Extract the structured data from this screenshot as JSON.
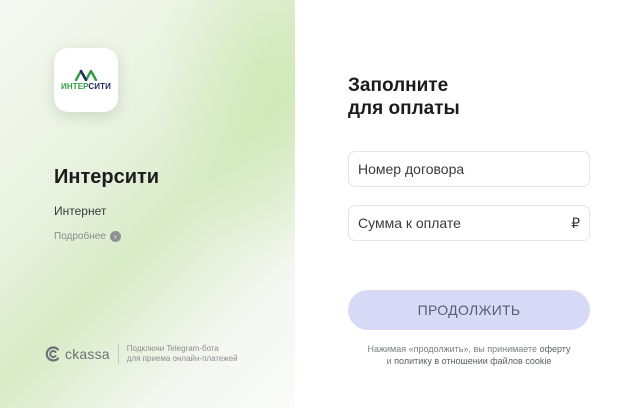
{
  "merchant": {
    "logo_text_green": "ИНТЕР",
    "logo_text_blue": "СИТИ",
    "name": "Интерсити",
    "service": "Интернет",
    "more_link": "Подробнее",
    "more_icon": "chevron-right-icon"
  },
  "footer": {
    "brand": "ckassa",
    "promo_line1": "Подключи Telegram-бота",
    "promo_line2": "для приема онлайн-платежей"
  },
  "form": {
    "title_line1": "Заполните",
    "title_line2": "для оплаты",
    "contract_placeholder": "Номер договора",
    "contract_value": "",
    "amount_placeholder": "Сумма к оплате",
    "amount_value": "",
    "currency_symbol": "₽",
    "submit_label": "ПРОДОЛЖИТЬ",
    "consent_prefix": "Нажимая «продолжить», вы принимаете",
    "consent_offer_link": "оферту",
    "consent_and": "и",
    "consent_policy_link": "политику в отношении файлов cookie"
  },
  "colors": {
    "brand_green": "#2e9e45",
    "brand_blue": "#23285f",
    "button_bg": "#d7daf7"
  }
}
